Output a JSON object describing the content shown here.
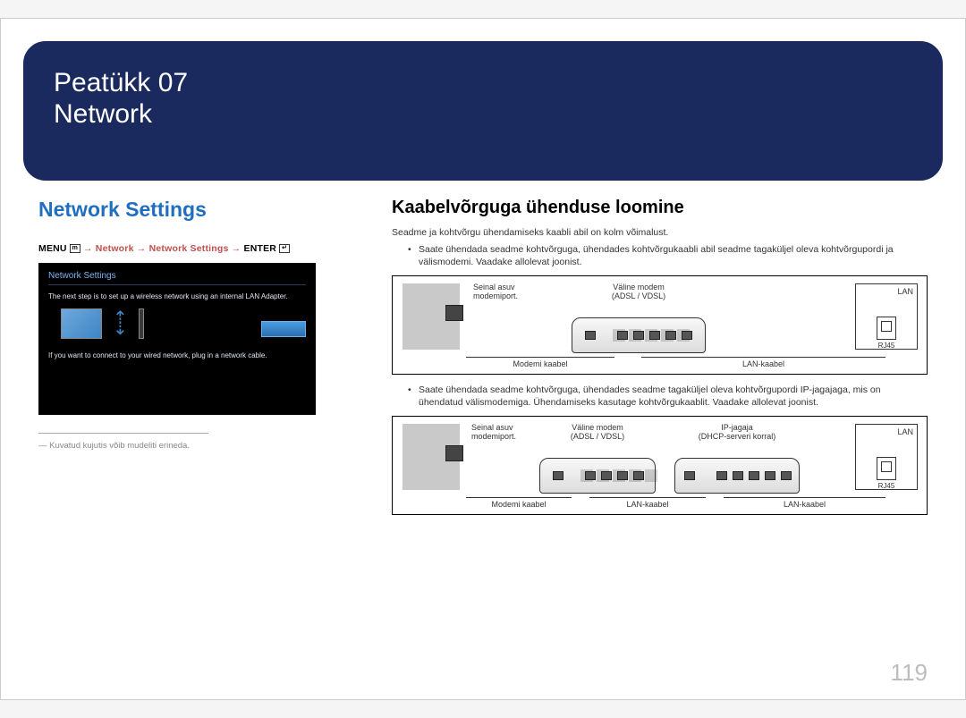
{
  "chapter": {
    "label": "Peatükk  07",
    "title": "Network"
  },
  "left": {
    "heading": "Network Settings",
    "menu_path": {
      "menu": "MENU",
      "arrow": "→",
      "p1": "Network",
      "p2": "Network Settings",
      "enter": "ENTER"
    },
    "screenshot": {
      "title": "Network Settings",
      "text1": "The next step is to set up a wireless network using an internal LAN Adapter.",
      "text2": "If you want to connect to your wired network, plug in a network cable."
    },
    "footnote": "―  Kuvatud kujutis võib mudeliti erineda."
  },
  "right": {
    "heading": "Kaabelvõrguga ühenduse loomine",
    "intro": "Seadme ja kohtvõrgu ühendamiseks kaabli abil on kolm võimalust.",
    "bullet1": "Saate ühendada seadme kohtvõrguga, ühendades kohtvõrgukaabli abil seadme tagaküljel oleva kohtvõrgupordi ja välismodemi. Vaadake allolevat joonist.",
    "bullet2": "Saate ühendada seadme kohtvõrguga, ühendades seadme tagaküljel oleva kohtvõrgupordi IP-jagajaga, mis on ühendatud välismodemiga. Ühendamiseks kasutage kohtvõrgukaablit. Vaadake allolevat joonist.",
    "diagram_labels": {
      "wall_port": "Seinal asuv modemiport.",
      "ext_modem": "Väline modem",
      "ext_modem_sub": "(ADSL / VDSL)",
      "ip_sharer": "IP-jagaja",
      "ip_sharer_sub": "(DHCP-serveri korral)",
      "lan": "LAN",
      "rj45": "RJ45",
      "modem_cable": "Modemi kaabel",
      "lan_cable": "LAN-kaabel"
    }
  },
  "page_number": "119"
}
